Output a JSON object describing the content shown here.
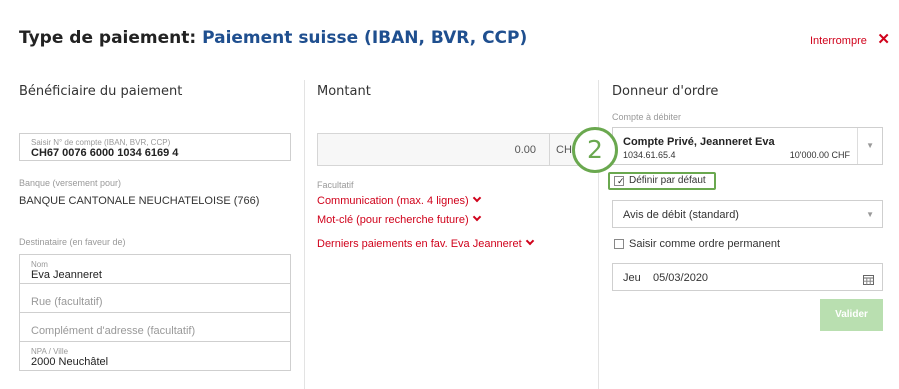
{
  "header": {
    "prefix": "Type de paiement:",
    "payment_type": "Paiement suisse (IBAN, BVR, CCP)",
    "abort_label": "Interrompre",
    "abort_icon": "✕"
  },
  "beneficiary": {
    "heading": "Bénéficiaire du paiement",
    "account_label": "Saisir N° de compte (IBAN, BVR, CCP)",
    "account_value": "CH67 0076 6000 1034 6169 4",
    "bank_label": "Banque (versement pour)",
    "bank_value": "BANQUE CANTONALE NEUCHATELOISE (766)",
    "recipient_label": "Destinataire (en faveur de)",
    "name_label": "Nom",
    "name_value": "Eva Jeanneret",
    "street_placeholder": "Rue (facultatif)",
    "address_placeholder": "Complément d'adresse (facultatif)",
    "city_label": "NPA / Ville",
    "city_value": "2000 Neuchâtel"
  },
  "amount": {
    "heading": "Montant",
    "value": "0.00",
    "currency": "CHF",
    "optional_label": "Facultatif",
    "link_communication": "Communication (max. 4 lignes)",
    "link_keyword": "Mot-clé (pour recherche future)",
    "link_last_payments": "Derniers paiements en fav. Eva Jeanneret"
  },
  "principal": {
    "heading": "Donneur d'ordre",
    "debit_label": "Compte à débiter",
    "account_name": "Compte Privé, Jeanneret Eva",
    "account_number": "1034.61.65.4",
    "account_balance": "10'000.00 CHF",
    "default_label": "Définir par défaut",
    "default_checked": true,
    "advice_value": "Avis de débit (standard)",
    "standing_order_label": "Saisir comme ordre permanent",
    "date_day": "Jeu",
    "date_value": "05/03/2020",
    "submit_label": "Valider"
  },
  "annotation": {
    "step_number": "2",
    "color": "#6aa84f"
  },
  "colors": {
    "accent_blue": "#1f4f8f",
    "link_red": "#d0021b",
    "submit_green": "#b9dfb0"
  }
}
